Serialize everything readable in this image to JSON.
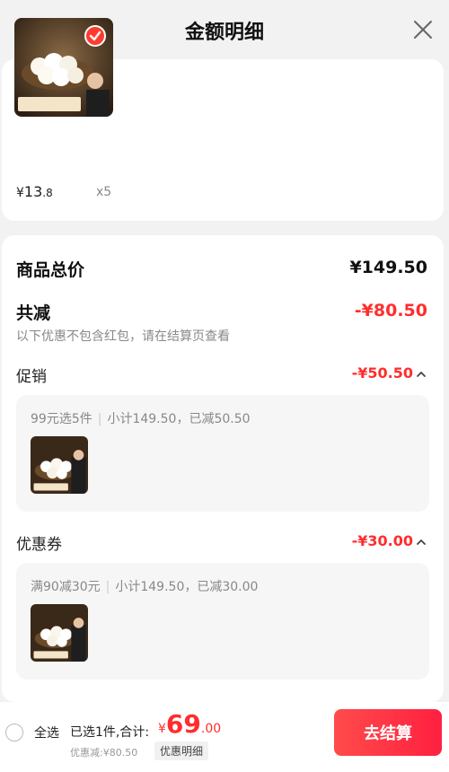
{
  "header": {
    "title": "金额明细"
  },
  "icons": {
    "close": "close-icon",
    "check": "check-icon",
    "chevron": "chevron-up-icon"
  },
  "colors": {
    "accent_red": "#ff2d2d",
    "checkout_gradient_start": "#ff4b4b",
    "checkout_gradient_end": "#ff2040"
  },
  "product": {
    "price_symbol": "¥",
    "price_int": "13",
    "price_dec": ".8",
    "quantity": "x5"
  },
  "detail": {
    "total_label": "商品总价",
    "total_amount": "¥149.50",
    "reduce_label": "共减",
    "reduce_amount": "-¥80.50",
    "note": "以下优惠不包含红包，请在结算页查看",
    "promo": {
      "label": "促销",
      "amount": "-¥50.50",
      "rule": "99元选5件",
      "summary": "小计149.50，已减50.50"
    },
    "coupon": {
      "label": "优惠券",
      "amount": "-¥30.00",
      "rule": "满90减30元",
      "summary": "小计149.50，已减30.00"
    }
  },
  "bottom": {
    "select_all": "全选",
    "selected": "已选1件,合计:",
    "total_symbol": "¥",
    "total_int": "69",
    "total_dec": ".00",
    "discount": "优惠减:¥80.50",
    "detail_button": "优惠明细",
    "checkout": "去结算"
  }
}
